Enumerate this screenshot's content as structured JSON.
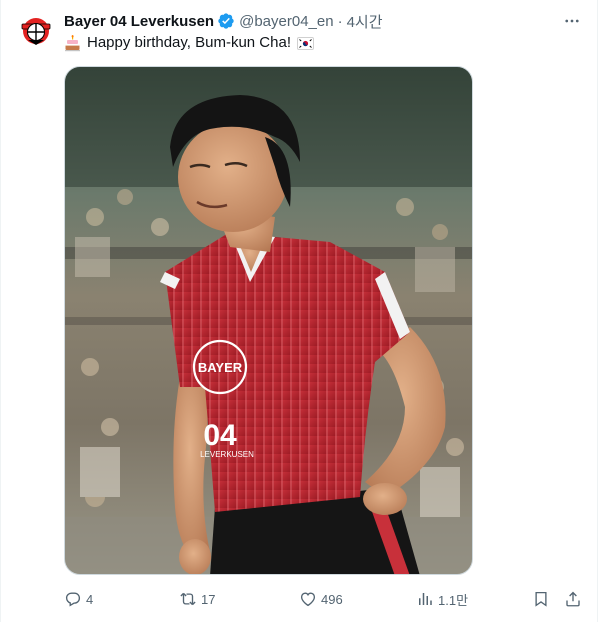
{
  "tweet": {
    "author_name": "Bayer 04 Leverkusen",
    "handle": "@bayer04_en",
    "separator": "·",
    "time": "4시간",
    "text": "Happy birthday, Bum-kun Cha!",
    "emoji_prefix": "birthday-cake",
    "emoji_suffix": "south-korea-flag",
    "image_alt": "Bum-kun Cha in a red Bayer 04 Leverkusen jersey running on the pitch in front of a crowd",
    "jersey_text": {
      "bayer": "BAYER",
      "number": "04",
      "club": "LEVERKUSEN"
    }
  },
  "metrics": {
    "replies": "4",
    "reposts": "17",
    "likes": "496",
    "views": "1.1만"
  },
  "colors": {
    "text": "#0f1419",
    "secondary": "#536471",
    "verified": "#1d9bf0",
    "jersey_red": "#b9232e",
    "crest_red": "#e32221"
  }
}
